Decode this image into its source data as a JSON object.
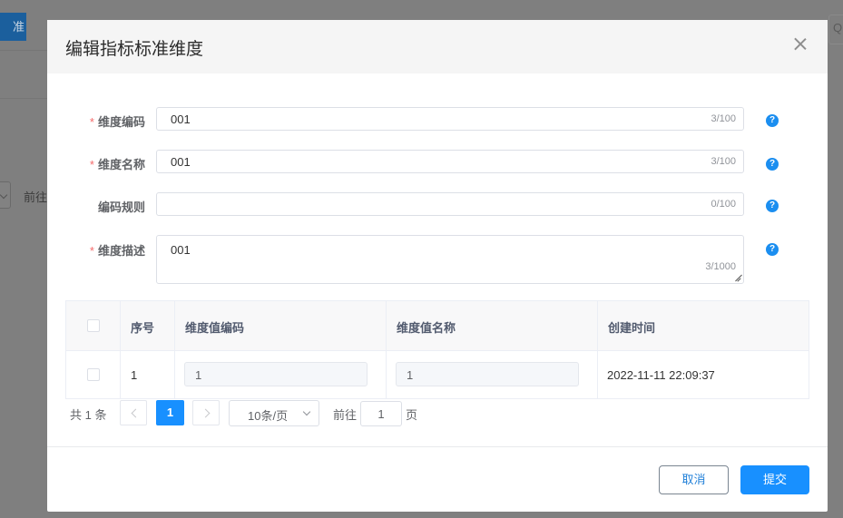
{
  "background": {
    "button_label": "准",
    "pager_text": "前往",
    "right_button_label": "Q"
  },
  "dialog": {
    "title": "编辑指标标准维度",
    "close_icon": "close-icon"
  },
  "form": {
    "required_mark": "*",
    "fields": [
      {
        "label": "维度编码",
        "required": true,
        "value": "001",
        "count": "3/100"
      },
      {
        "label": "维度名称",
        "required": true,
        "value": "001",
        "count": "3/100"
      },
      {
        "label": "编码规则",
        "required": false,
        "value": "",
        "count": "0/100"
      },
      {
        "label": "维度描述",
        "required": true,
        "value": "001",
        "count": "3/1000"
      }
    ],
    "help_icon": "?"
  },
  "table": {
    "headers": [
      "序号",
      "维度值编码",
      "维度值名称",
      "创建时间"
    ],
    "rows": [
      {
        "index": "1",
        "code": "1",
        "name": "1",
        "created": "2022-11-11 22:09:37"
      }
    ]
  },
  "pagination": {
    "total": "共 1 条",
    "current_page": "1",
    "page_size": "10条/页",
    "goto_label": "前往",
    "goto_value": "1",
    "page_suffix": "页"
  },
  "footer": {
    "cancel_label": "取消",
    "submit_label": "提交"
  },
  "colors": {
    "primary": "#1890ff",
    "required": "#f56c6c",
    "overlay": "#7f7f7f"
  }
}
